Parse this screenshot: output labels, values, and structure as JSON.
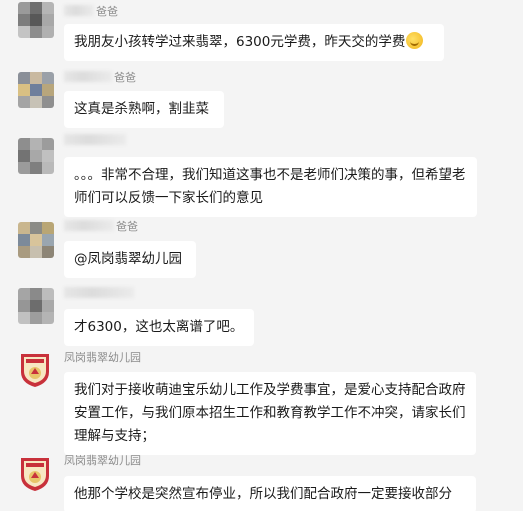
{
  "messages": [
    {
      "sender": "爸爸",
      "text": "我朋友小孩转学过来翡翠，6300元学费，昨天交的学费",
      "emoji": "money-mouth-face"
    },
    {
      "sender": "爸爸",
      "text": "这真是杀熟啊，割韭菜"
    },
    {
      "sender": "",
      "text": "。。。非常不合理，我们知道这事也不是老师们决策的事，但希望老师们可以反馈一下家长们的意见"
    },
    {
      "sender": "爸爸",
      "text": "@凤岗翡翠幼儿园"
    },
    {
      "sender": "",
      "text": "才6300，这也太离谱了吧。"
    },
    {
      "sender": "凤岗翡翠幼儿园",
      "text": "我们对于接收萌迪宝乐幼儿工作及学费事宜，是爱心支持配合政府安置工作，与我们原本招生工作和教育教学工作不冲突，请家长们理解与支持；"
    },
    {
      "sender": "凤岗翡翠幼儿园",
      "text": "他那个学校是突然宣布停业，所以我们配合政府一定要接收部分"
    }
  ],
  "colors": {
    "background": "#f4f4f4",
    "bubble": "#ffffff",
    "name": "#8c8c8c",
    "logo_red": "#c8313b",
    "logo_gold": "#e8c56a"
  }
}
